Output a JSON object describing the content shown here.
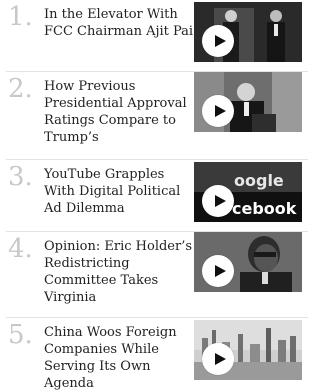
{
  "items": [
    {
      "number": "1.",
      "headline": "In the Elevator With FCC Chairman Ajit Pai",
      "thumb_icon": "play-icon"
    },
    {
      "number": "2.",
      "headline": "How Previous Presidential Approval Ratings Compare to Trump’s",
      "thumb_icon": "play-icon"
    },
    {
      "number": "3.",
      "headline": "YouTube Grapples With Digital Political Ad Dilemma",
      "thumb_icon": "play-icon",
      "thumb_text": {
        "top": "oogle",
        "bottom": "cebook"
      }
    },
    {
      "number": "4.",
      "headline": "Opinion: Eric Holder’s Redistricting Committee Takes Virginia",
      "thumb_icon": "play-icon"
    },
    {
      "number": "5.",
      "headline": "China Woos Foreign Companies While Serving Its Own Agenda",
      "thumb_icon": "play-icon"
    }
  ],
  "colors": {
    "number": "#c8c8c8",
    "headline": "#222222",
    "divider": "#e3e3e3",
    "play_bg": "#ffffff",
    "play_glyph": "#111111"
  }
}
